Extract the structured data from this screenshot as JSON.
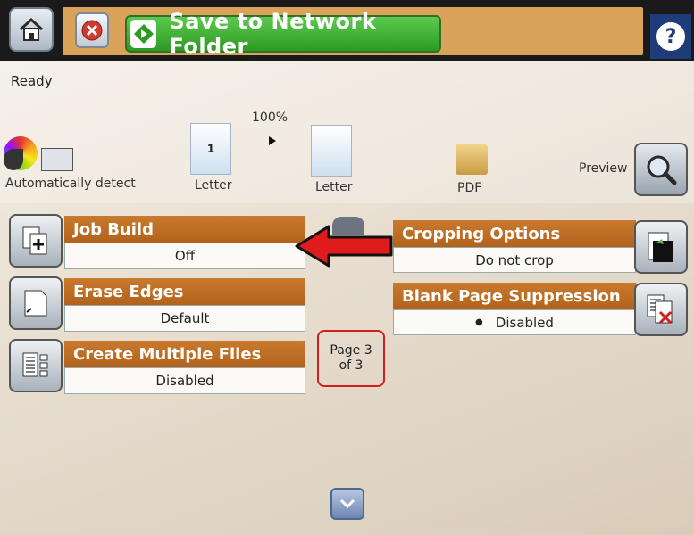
{
  "header": {
    "action_label": "Save to Network Folder",
    "home_icon": "home-icon",
    "cancel_icon": "cancel-icon",
    "help_glyph": "?"
  },
  "status": {
    "text": "Ready"
  },
  "summary": {
    "color_mode_label": "Automatically detect",
    "zoom": "100%",
    "original_page_number": "1",
    "original_size": "Letter",
    "output_size": "Letter",
    "file_type": "PDF",
    "preview_label": "Preview"
  },
  "options": {
    "job_build": {
      "title": "Job Build",
      "value": "Off"
    },
    "erase_edges": {
      "title": "Erase Edges",
      "value": "Default"
    },
    "create_multiple_files": {
      "title": "Create Multiple Files",
      "value": "Disabled"
    },
    "cropping_options": {
      "title": "Cropping Options",
      "value": "Do not crop"
    },
    "blank_page_suppression": {
      "title": "Blank Page Suppression",
      "value": "Disabled"
    }
  },
  "pagination": {
    "line1": "Page 3",
    "line2": "of 3"
  },
  "colors": {
    "title_bar": "#b96a22",
    "start_green": "#3aa82f",
    "help_blue": "#1f3c7a",
    "highlight_red": "#d21e1e"
  }
}
